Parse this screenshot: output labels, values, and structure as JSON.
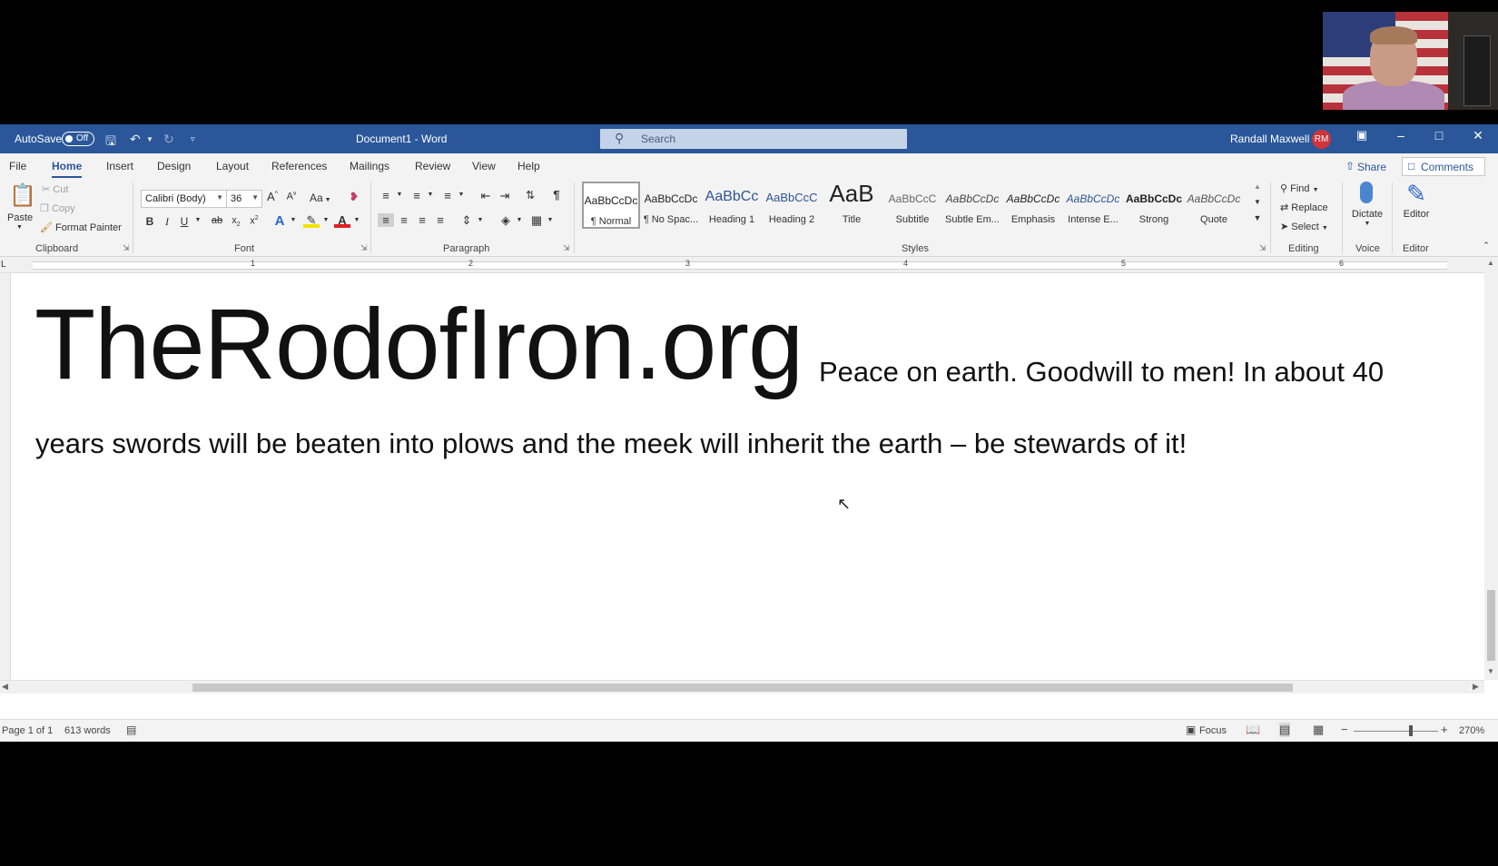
{
  "titlebar": {
    "autosave_label": "AutoSave",
    "autosave_state": "Off",
    "document_title": "Document1 - Word",
    "search_placeholder": "Search",
    "user_name": "Randall Maxwell",
    "user_initials": "RM"
  },
  "tabs": [
    "File",
    "Home",
    "Insert",
    "Design",
    "Layout",
    "References",
    "Mailings",
    "Review",
    "View",
    "Help"
  ],
  "active_tab": "Home",
  "share_label": "Share",
  "comments_label": "Comments",
  "clipboard": {
    "paste": "Paste",
    "cut": "Cut",
    "copy": "Copy",
    "format_painter": "Format Painter",
    "group_label": "Clipboard"
  },
  "font": {
    "family": "Calibri (Body)",
    "size": "36",
    "change_case": "Aa",
    "group_label": "Font"
  },
  "paragraph": {
    "group_label": "Paragraph"
  },
  "styles": {
    "items": [
      {
        "sample": "AaBbCcDc",
        "name": "¶ Normal"
      },
      {
        "sample": "AaBbCcDc",
        "name": "¶ No Spac..."
      },
      {
        "sample": "AaBbCc",
        "name": "Heading 1"
      },
      {
        "sample": "AaBbCcC",
        "name": "Heading 2"
      },
      {
        "sample": "AaB",
        "name": "Title"
      },
      {
        "sample": "AaBbCcC",
        "name": "Subtitle"
      },
      {
        "sample": "AaBbCcDc",
        "name": "Subtle Em..."
      },
      {
        "sample": "AaBbCcDc",
        "name": "Emphasis"
      },
      {
        "sample": "AaBbCcDc",
        "name": "Intense E..."
      },
      {
        "sample": "AaBbCcDc",
        "name": "Strong"
      },
      {
        "sample": "AaBbCcDc",
        "name": "Quote"
      }
    ],
    "group_label": "Styles"
  },
  "editing": {
    "find": "Find",
    "replace": "Replace",
    "select": "Select",
    "group_label": "Editing"
  },
  "voice": {
    "dictate": "Dictate",
    "group_label": "Voice"
  },
  "editor": {
    "label": "Editor",
    "group_label": "Editor"
  },
  "ruler": {
    "corner": "L",
    "numbers": [
      "1",
      "2",
      "3",
      "4",
      "5",
      "6"
    ]
  },
  "document": {
    "heading": "TheRodofIron.org",
    "line1": "Peace on earth.  Goodwill to men!  In about 40",
    "line2": "years swords will be beaten into plows and the meek will inherit the earth – be stewards of it!"
  },
  "status": {
    "page": "Page 1 of 1",
    "words": "613 words",
    "focus": "Focus",
    "zoom": "270%"
  },
  "colors": {
    "titlebar": "#2b579a",
    "ribbon": "#f3f3f3",
    "avatar": "#d13438"
  }
}
